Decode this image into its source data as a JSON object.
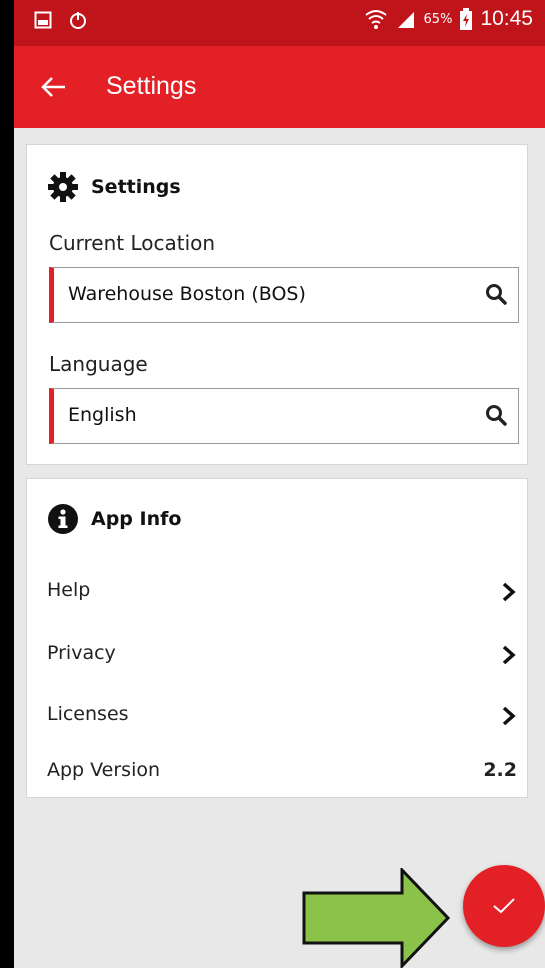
{
  "status_bar": {
    "battery": "65%",
    "time": "10:45"
  },
  "app_bar": {
    "title": "Settings"
  },
  "settings_card": {
    "title": "Settings",
    "location_label": "Current Location",
    "location_value": "Warehouse Boston (BOS)",
    "language_label": "Language",
    "language_value": "English"
  },
  "app_info_card": {
    "title": "App Info",
    "items": [
      {
        "label": "Help"
      },
      {
        "label": "Privacy"
      },
      {
        "label": "Licenses"
      }
    ],
    "version_label": "App Version",
    "version_value": "2.2"
  },
  "colors": {
    "accent": "#e42027",
    "status_bar": "#c0141b",
    "callout_arrow": "#8bc34a"
  },
  "icons": [
    "gallery-icon",
    "sync-icon",
    "wifi-icon",
    "signal-icon",
    "battery-icon",
    "back-arrow-icon",
    "gear-icon",
    "search-icon",
    "info-icon",
    "chevron-right-icon",
    "check-icon"
  ]
}
